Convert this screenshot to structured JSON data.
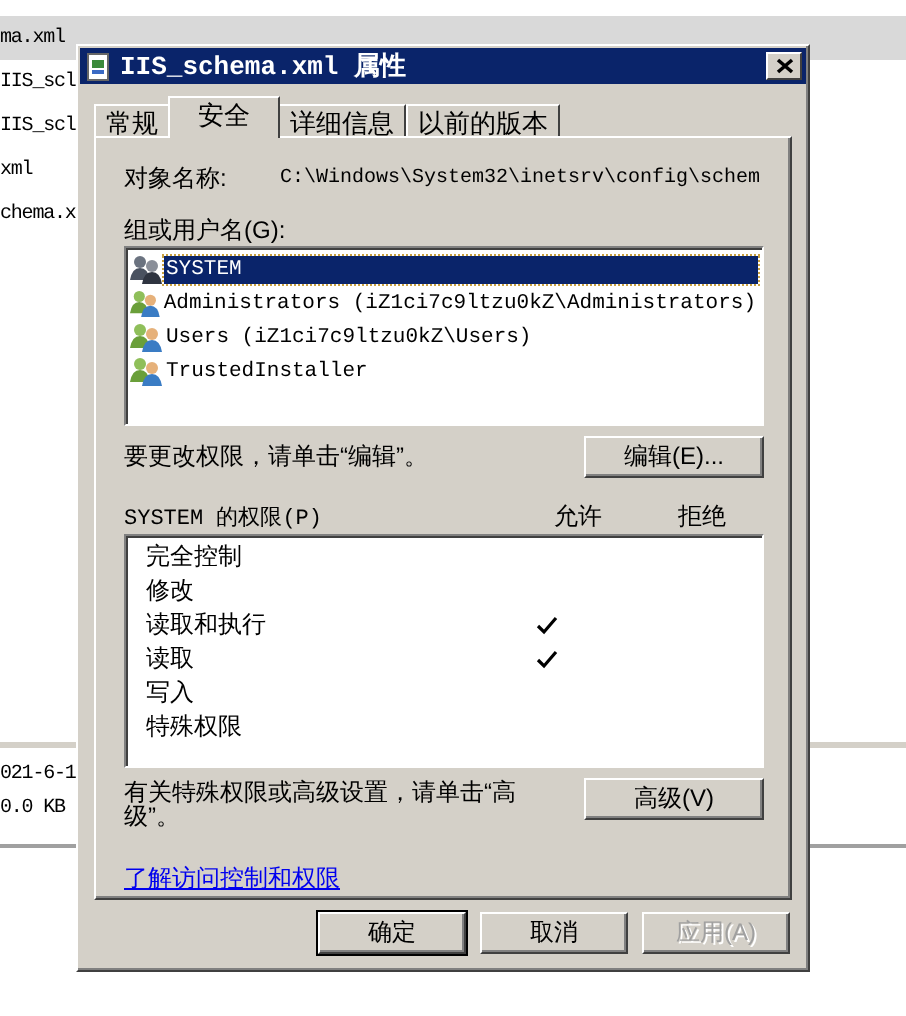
{
  "explorer": {
    "rows": [
      {
        "name": "ma.xml",
        "selected": true
      },
      {
        "name": "IIS_scl",
        "selected": false
      },
      {
        "name": "IIS_scl",
        "selected": false
      },
      {
        "name": "xml",
        "selected": false
      },
      {
        "name": "chema.x",
        "selected": false
      }
    ],
    "details": [
      "021-6-1",
      "0.0 KB"
    ]
  },
  "dialog": {
    "title": "IIS_schema.xml 属性",
    "tabs": [
      {
        "label": "常规",
        "selected": false
      },
      {
        "label": "安全",
        "selected": true
      },
      {
        "label": "详细信息",
        "selected": false
      },
      {
        "label": "以前的版本",
        "selected": false
      }
    ],
    "object_name": {
      "label": "对象名称:",
      "value": "C:\\Windows\\System32\\inetsrv\\config\\schem"
    },
    "group_label": "组或用户名(G):",
    "users": [
      {
        "name": "SYSTEM",
        "selected": true
      },
      {
        "name": "Administrators (iZ1ci7c9ltzu0kZ\\Administrators)",
        "selected": false
      },
      {
        "name": "Users (iZ1ci7c9ltzu0kZ\\Users)",
        "selected": false
      },
      {
        "name": "TrustedInstaller",
        "selected": false
      }
    ],
    "edit_hint": "要更改权限，请单击“编辑”。",
    "edit_button": "编辑(E)...",
    "permissions": {
      "title": "SYSTEM 的权限(P)",
      "columns": [
        "允许",
        "拒绝"
      ],
      "rows": [
        {
          "name": "完全控制",
          "allow": false,
          "deny": false
        },
        {
          "name": "修改",
          "allow": false,
          "deny": false
        },
        {
          "name": "读取和执行",
          "allow": true,
          "deny": false
        },
        {
          "name": "读取",
          "allow": true,
          "deny": false
        },
        {
          "name": "写入",
          "allow": false,
          "deny": false
        },
        {
          "name": "特殊权限",
          "allow": false,
          "deny": false
        }
      ]
    },
    "advanced_hint": "有关特殊权限或高级设置，请单击“高级”。",
    "advanced_button": "高级(V)",
    "link": "了解访问控制和权限",
    "buttons": [
      {
        "label": "确定",
        "kind": "default",
        "disabled": false
      },
      {
        "label": "取消",
        "kind": "normal",
        "disabled": false
      },
      {
        "label": "应用(A)",
        "kind": "normal",
        "disabled": true
      }
    ]
  }
}
